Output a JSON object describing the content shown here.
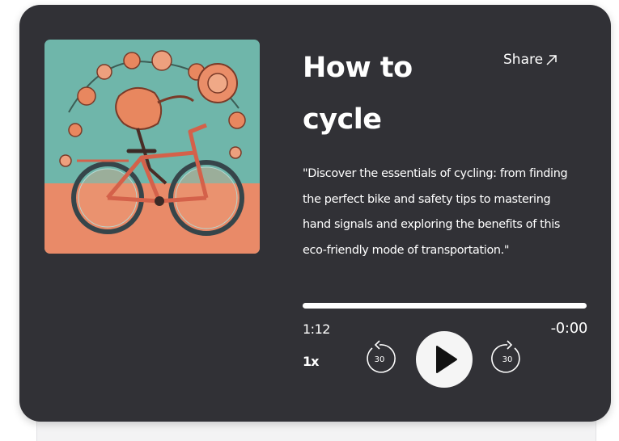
{
  "episode": {
    "title": "How to cycle",
    "share_label": "Share",
    "description": "\"Discover the essentials of cycling: from finding the perfect bike and safety tips to mastering hand signals and exploring the benefits of this eco-friendly mode of transportation.\"",
    "artwork_icon": "bicycle-flower-illustration"
  },
  "player": {
    "current_time": "1:12",
    "remaining_time": "-0:00",
    "speed": "1x",
    "skip_back_seconds": "30",
    "skip_forward_seconds": "30",
    "progress": 1.0
  },
  "colors": {
    "card_background": "#313136",
    "text": "#ffffff",
    "artwork_teal": "#6fb6aa",
    "artwork_coral": "#e98a68"
  }
}
